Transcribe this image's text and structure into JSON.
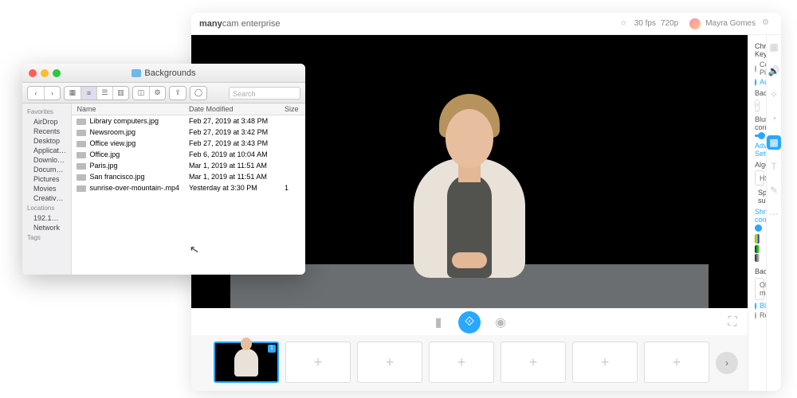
{
  "mc": {
    "brand_bold": "many",
    "brand_rest": "cam enterprise",
    "fps": "30 fps",
    "res": "720p",
    "user": "Mayra Gomes",
    "thumbs_badge": "1"
  },
  "panel": {
    "chroma": "Chroma Key",
    "color_picker": "Color Picker",
    "auto": "Auto",
    "background": "Background",
    "blur": "Blur contour",
    "advanced": "Advanced Settings",
    "algorithm": "Algorithm",
    "algo_val": "HSL",
    "spill": "Spill suppression",
    "shrink": "Shrink contour",
    "bg2": "Background",
    "bg2_val": "Old model",
    "opt_blur": "Blur",
    "opt_remove": "Remove"
  },
  "finder": {
    "title": "Backgrounds",
    "search_ph": "Search",
    "sidebar": {
      "fav": "Favorites",
      "items": [
        "AirDrop",
        "Recents",
        "Desktop",
        "Applicati…",
        "Downloads",
        "Docume…",
        "Pictures",
        "Movies",
        "Creative…"
      ],
      "loc": "Locations",
      "loc_items": [
        "192.1…",
        "Network"
      ],
      "tags": "Tags"
    },
    "cols": {
      "name": "Name",
      "date": "Date Modified",
      "size": "Size"
    },
    "rows": [
      {
        "n": "Library computers.jpg",
        "d": "Feb 27, 2019 at 3:48 PM",
        "s": ""
      },
      {
        "n": "Newsroom.jpg",
        "d": "Feb 27, 2019 at 3:42 PM",
        "s": ""
      },
      {
        "n": "Office view.jpg",
        "d": "Feb 27, 2019 at 3:43 PM",
        "s": ""
      },
      {
        "n": "Office.jpg",
        "d": "Feb 6, 2019 at 10:04 AM",
        "s": ""
      },
      {
        "n": "Paris.jpg",
        "d": "Mar 1, 2019 at 11:51 AM",
        "s": ""
      },
      {
        "n": "San francisco.jpg",
        "d": "Mar 1, 2019 at 11:51 AM",
        "s": ""
      },
      {
        "n": "sunrise-over-mountain-.mp4",
        "d": "Yesterday at 3:30 PM",
        "s": "1"
      }
    ]
  }
}
